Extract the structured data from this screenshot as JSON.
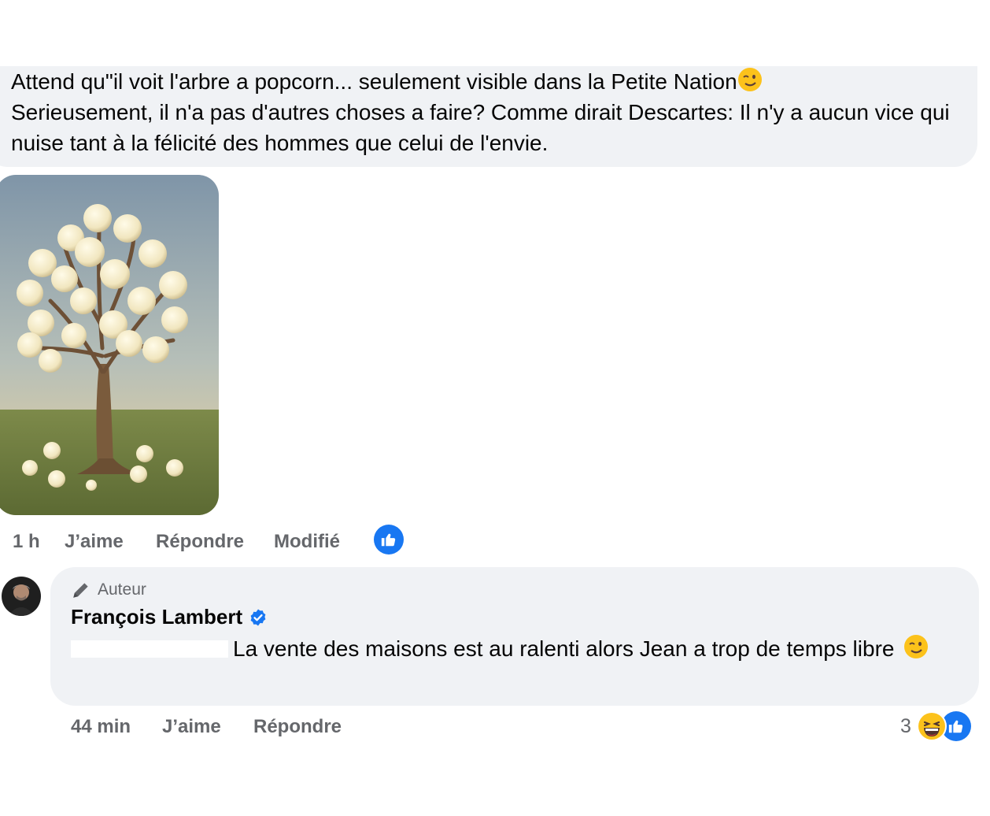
{
  "comment1": {
    "text": "Attend qu\"il voit l'arbre a popcorn... seulement visible dans la Petite Nation",
    "text2": "Serieusement, il n'a pas d'autres choses a faire? Comme dirait Descartes: Il n'y a aucun vice qui nuise tant à la félicité des hommes que celui de l'envie.",
    "actions": {
      "time": "1 h",
      "like": "J’aime",
      "reply": "Répondre",
      "edited": "Modifié"
    }
  },
  "comment2": {
    "badge": "Auteur",
    "author": "François Lambert",
    "text": "La vente des maisons est au ralenti alors Jean a trop de temps libre",
    "actions": {
      "time": "44 min",
      "like": "J’aime",
      "reply": "Répondre"
    },
    "reaction_count": "3"
  },
  "colors": {
    "bubble": "#f0f2f5",
    "meta": "#65676b",
    "facebook_blue": "#1877f2"
  },
  "icons": [
    "wink-emoji",
    "thumbs-up-icon",
    "pencil-icon",
    "verified-badge-icon",
    "laughing-emoji"
  ]
}
